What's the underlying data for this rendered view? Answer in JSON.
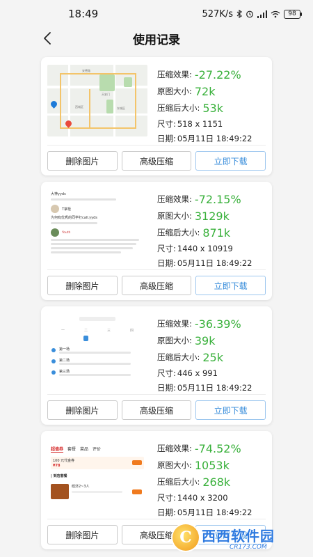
{
  "status_bar": {
    "time": "18:49",
    "network_speed": "527K/s",
    "battery": "98",
    "icons": [
      "bluetooth-icon",
      "alarm-icon",
      "signal-icon",
      "wifi-icon",
      "battery-icon"
    ]
  },
  "nav": {
    "title": "使用记录",
    "back_icon": "chevron-left-icon"
  },
  "labels": {
    "compression_effect": "压缩效果:",
    "original_size": "原图大小:",
    "compressed_size": "压缩后大小:",
    "dimensions": "尺寸:",
    "date": "日期:"
  },
  "buttons": {
    "delete": "删除图片",
    "advanced": "高级压缩",
    "download": "立即下载"
  },
  "records": [
    {
      "effect": "-27.22%",
      "original": "72k",
      "compressed": "53k",
      "dimensions": "518 x 1151",
      "date": "05月11日 18:49:22",
      "thumb": "map"
    },
    {
      "effect": "-72.15%",
      "original": "3129k",
      "compressed": "871k",
      "dimensions": "1440 x 10919",
      "date": "05月11日 18:49:22",
      "thumb": "chat"
    },
    {
      "effect": "-36.39%",
      "original": "39k",
      "compressed": "25k",
      "dimensions": "446 x 991",
      "date": "05月11日 18:49:22",
      "thumb": "calendar"
    },
    {
      "effect": "-74.52%",
      "original": "1053k",
      "compressed": "268k",
      "dimensions": "1440 x 3200",
      "date": "05月11日 18:49:22",
      "thumb": "food"
    }
  ],
  "thumb_text": {
    "chat_header": "大神yyds",
    "chat_quote": "为何有优秀的同学打call.yyds",
    "chat_name": "T掌柜",
    "chat_tag": "Youth",
    "map_labels": [
      "安德路",
      "天安门",
      "东城区",
      "西城区"
    ],
    "calendar_days": [
      "一",
      "二",
      "三",
      "四"
    ],
    "calendar_items": [
      "第一场",
      "第二场",
      "第三场"
    ],
    "food_tabs": [
      "超值券",
      "套餐",
      "菜品",
      "评价"
    ],
    "food_coupon": "100 元代金券",
    "food_price": "¥78",
    "food_section": "| 到店套餐",
    "food_dish": "经济2~3人"
  },
  "watermark": {
    "logo_glyph": "C",
    "text": "西西软件园",
    "sub": "CR173.COM"
  },
  "colors": {
    "green": "#38b03a",
    "primary_blue": "#3a8edb",
    "background": "#f4f4f4"
  }
}
